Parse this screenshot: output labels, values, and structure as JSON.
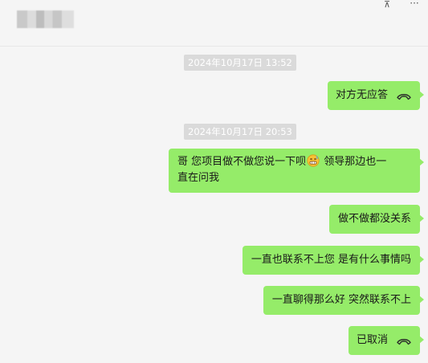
{
  "header": {
    "pin_icon": "pin-icon",
    "pin_glyph": "⊼",
    "more_icon": "more-icon",
    "more_glyph": "···"
  },
  "messages": [
    {
      "type": "timestamp",
      "text": "2024年10月17日 13:52"
    },
    {
      "type": "call",
      "text": "对方无应答",
      "icon": "phone-hangup-icon"
    },
    {
      "type": "timestamp",
      "text": "2024年10月17日 20:53"
    },
    {
      "type": "text",
      "text_before": "哥  您项目做不做您说一下呗",
      "emoji": "grimace-emoji-icon",
      "text_after_line1": "  领导那边也一",
      "text_line2": "直在问我"
    },
    {
      "type": "text",
      "text": "做不做都没关系"
    },
    {
      "type": "text",
      "text": "一直也联系不上您 是有什么事情吗"
    },
    {
      "type": "text",
      "text": "一直聊得那么好  突然联系不上"
    },
    {
      "type": "call",
      "text": "已取消",
      "icon": "phone-hangup-icon"
    }
  ],
  "colors": {
    "bubble": "#95ec69",
    "timestamp_bg": "#dadada",
    "background": "#f5f5f5"
  }
}
